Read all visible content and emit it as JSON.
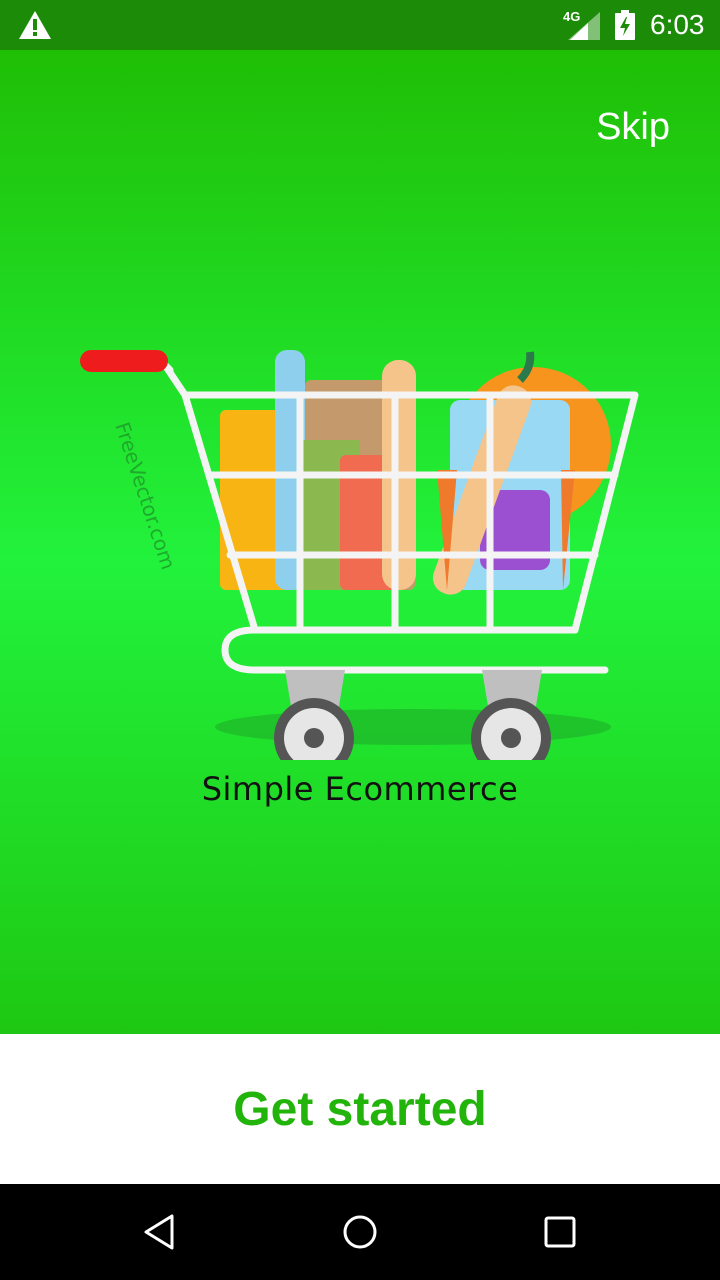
{
  "status_bar": {
    "network": "4G",
    "time": "6:03",
    "icons": [
      "warning-icon",
      "signal-icon",
      "battery-icon"
    ]
  },
  "onboarding": {
    "skip_label": "Skip",
    "app_name": "Simple Ecommerce",
    "watermark": "FreeVector.com",
    "get_started_label": "Get started"
  },
  "colors": {
    "status_bar": "#1c8c08",
    "hero_top": "#1fbf05",
    "hero_mid": "#22f23c",
    "accent": "#22b40b"
  },
  "nav_bar": {
    "icons": [
      "back-icon",
      "home-icon",
      "recents-icon"
    ]
  }
}
